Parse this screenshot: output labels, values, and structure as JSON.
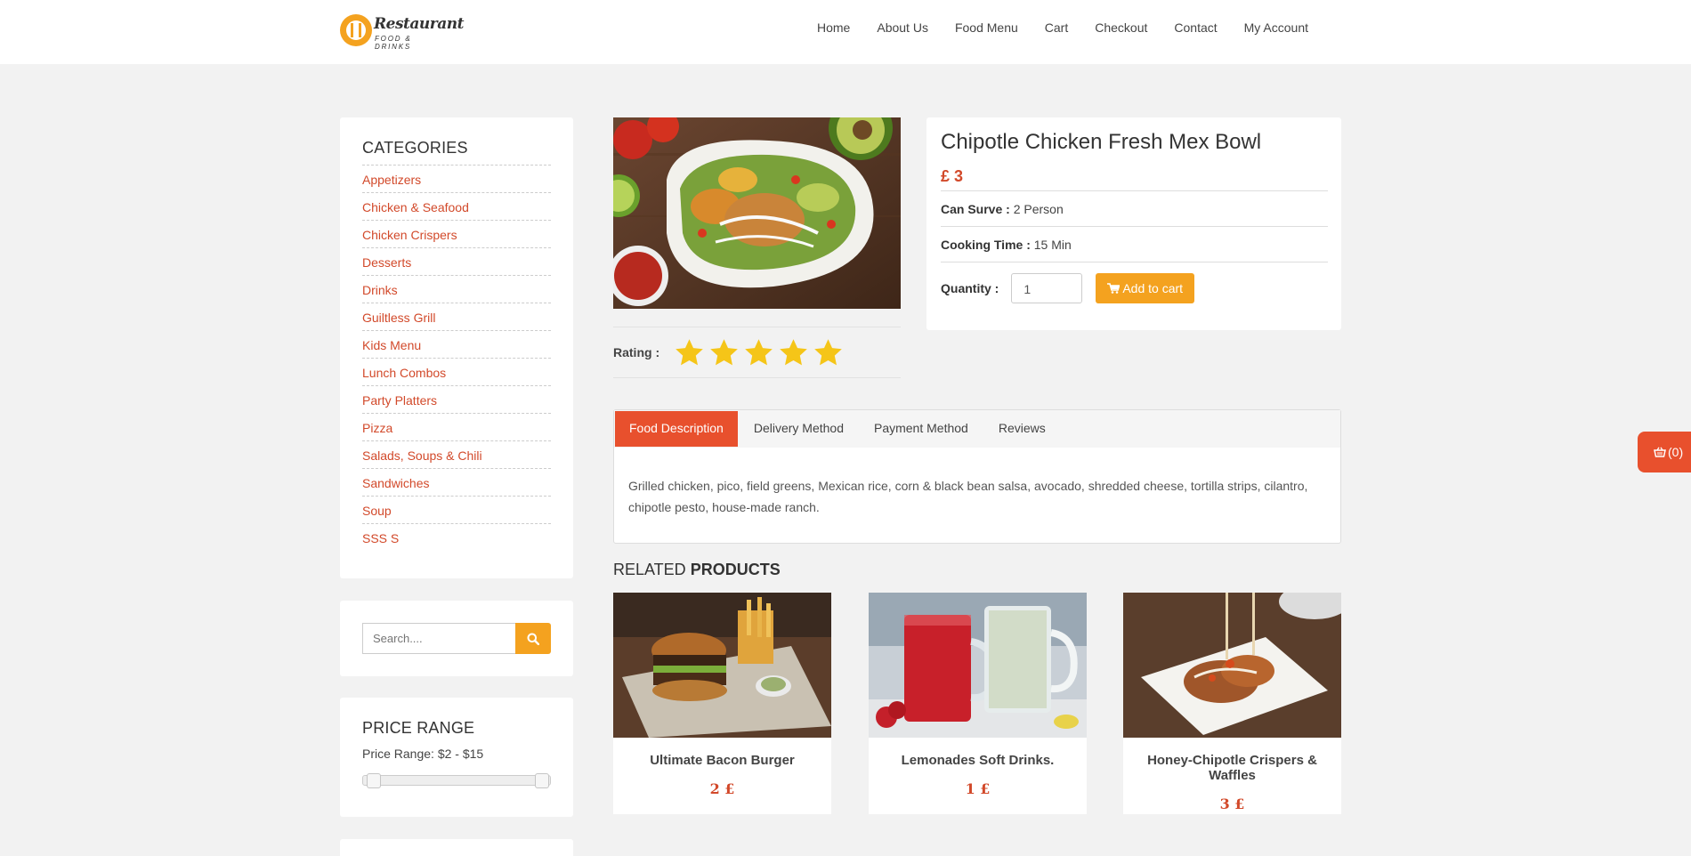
{
  "logo": {
    "title": "Restaurant",
    "subtitle": "FOOD & DRINKS"
  },
  "nav": [
    "Home",
    "About Us",
    "Food Menu",
    "Cart",
    "Checkout",
    "Contact",
    "My Account"
  ],
  "categories": {
    "title": "CATEGORIES",
    "items": [
      "Appetizers",
      "Chicken & Seafood",
      "Chicken Crispers",
      "Desserts",
      "Drinks",
      "Guiltless Grill",
      "Kids Menu",
      "Lunch Combos",
      "Party Platters",
      "Pizza",
      "Salads, Soups & Chili",
      "Sandwiches",
      "Soup",
      "SSS S"
    ]
  },
  "search": {
    "placeholder": "Search....",
    "icon": "search-icon"
  },
  "price_range": {
    "title": "PRICE RANGE",
    "label": "Price Range: $2 - $15"
  },
  "product": {
    "name": "Chipotle Chicken Fresh Mex Bowl",
    "price": "£ 3",
    "serves_label": "Can Surve :",
    "serves_value": "2 Person",
    "cooking_label": "Cooking Time :",
    "cooking_value": "15 Min",
    "quantity_label": "Quantity :",
    "quantity_value": "1",
    "add_to_cart": "Add to cart",
    "rating_label": "Rating :",
    "rating": 5,
    "rating_max": 5
  },
  "tabs": {
    "items": [
      "Food Description",
      "Delivery Method",
      "Payment Method",
      "Reviews"
    ],
    "active": "Food Description",
    "content": "Grilled chicken, pico, field greens, Mexican rice, corn & black bean salsa, avocado, shredded cheese, tortilla strips, cilantro, chipotle pesto, house-made ranch."
  },
  "related": {
    "title_light": "RELATED",
    "title_bold": "PRODUCTS",
    "items": [
      {
        "name": "Ultimate Bacon Burger",
        "price": "2 £"
      },
      {
        "name": "Lemonades Soft Drinks.",
        "price": "1 £"
      },
      {
        "name": "Honey-Chipotle Crispers & Waffles",
        "price": "3 £"
      }
    ]
  },
  "cart_float": {
    "count": "(0)"
  },
  "colors": {
    "accent": "#e8502d",
    "button": "#f4a21f",
    "link": "#d2492a",
    "star": "#f5c518"
  }
}
